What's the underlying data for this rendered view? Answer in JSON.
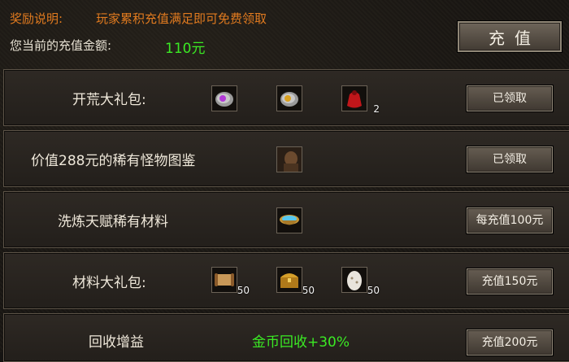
{
  "header": {
    "reward_label": "奖励说明:",
    "reward_desc": "玩家累积充值满足即可免费领取",
    "amount_label": "您当前的充值金额:",
    "amount_value": "110元",
    "recharge_button": "充值"
  },
  "rows": [
    {
      "title": "开荒大礼包:",
      "items": [
        {
          "icon": "purple-rune-stone-icon",
          "qty": ""
        },
        {
          "icon": "gold-rune-stone-icon",
          "qty": ""
        },
        {
          "icon": "red-potion-bag-icon",
          "qty": "2"
        }
      ],
      "button": "已领取"
    },
    {
      "title": "价值288元的稀有怪物图鉴",
      "items": [
        {
          "icon": "monster-portrait-icon",
          "qty": ""
        }
      ],
      "button": "已领取"
    },
    {
      "title": "洗炼天赋稀有材料",
      "items": [
        {
          "icon": "crystal-bowl-icon",
          "qty": ""
        }
      ],
      "button": "每充值100元"
    },
    {
      "title": "材料大礼包:",
      "items": [
        {
          "icon": "scroll-icon",
          "qty": "50"
        },
        {
          "icon": "treasure-chest-icon",
          "qty": "50"
        },
        {
          "icon": "egg-icon",
          "qty": "50"
        }
      ],
      "button": "充值150元"
    },
    {
      "title": "回收增益",
      "bonus_text": "金币回收+30%",
      "button": "充值200元"
    }
  ],
  "colors": {
    "accent_orange": "#e07a1f",
    "highlight_green": "#3bea24",
    "text_light": "#efe8da",
    "panel_border": "#5c5347"
  }
}
